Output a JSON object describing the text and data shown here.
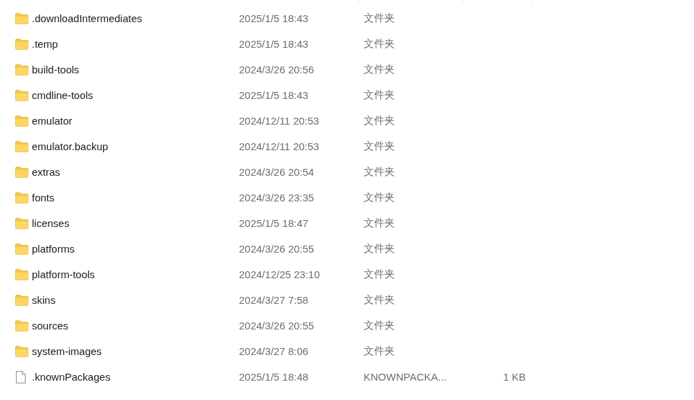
{
  "files": [
    {
      "name": ".downloadIntermediates",
      "modified": "2025/1/5 18:43",
      "type": "文件夹",
      "kind": "folder"
    },
    {
      "name": ".temp",
      "modified": "2025/1/5 18:43",
      "type": "文件夹",
      "kind": "folder"
    },
    {
      "name": "build-tools",
      "modified": "2024/3/26 20:56",
      "type": "文件夹",
      "kind": "folder"
    },
    {
      "name": "cmdline-tools",
      "modified": "2025/1/5 18:43",
      "type": "文件夹",
      "kind": "folder"
    },
    {
      "name": "emulator",
      "modified": "2024/12/11 20:53",
      "type": "文件夹",
      "kind": "folder"
    },
    {
      "name": "emulator.backup",
      "modified": "2024/12/11 20:53",
      "type": "文件夹",
      "kind": "folder"
    },
    {
      "name": "extras",
      "modified": "2024/3/26 20:54",
      "type": "文件夹",
      "kind": "folder"
    },
    {
      "name": "fonts",
      "modified": "2024/3/26 23:35",
      "type": "文件夹",
      "kind": "folder"
    },
    {
      "name": "licenses",
      "modified": "2025/1/5 18:47",
      "type": "文件夹",
      "kind": "folder"
    },
    {
      "name": "platforms",
      "modified": "2024/3/26 20:55",
      "type": "文件夹",
      "kind": "folder"
    },
    {
      "name": "platform-tools",
      "modified": "2024/12/25 23:10",
      "type": "文件夹",
      "kind": "folder"
    },
    {
      "name": "skins",
      "modified": "2024/3/27 7:58",
      "type": "文件夹",
      "kind": "folder"
    },
    {
      "name": "sources",
      "modified": "2024/3/26 20:55",
      "type": "文件夹",
      "kind": "folder"
    },
    {
      "name": "system-images",
      "modified": "2024/3/27 8:06",
      "type": "文件夹",
      "kind": "folder"
    },
    {
      "name": ".knownPackages",
      "modified": "2025/1/5 18:48",
      "type": "KNOWNPACKA...",
      "size": "1 KB",
      "kind": "file"
    }
  ]
}
